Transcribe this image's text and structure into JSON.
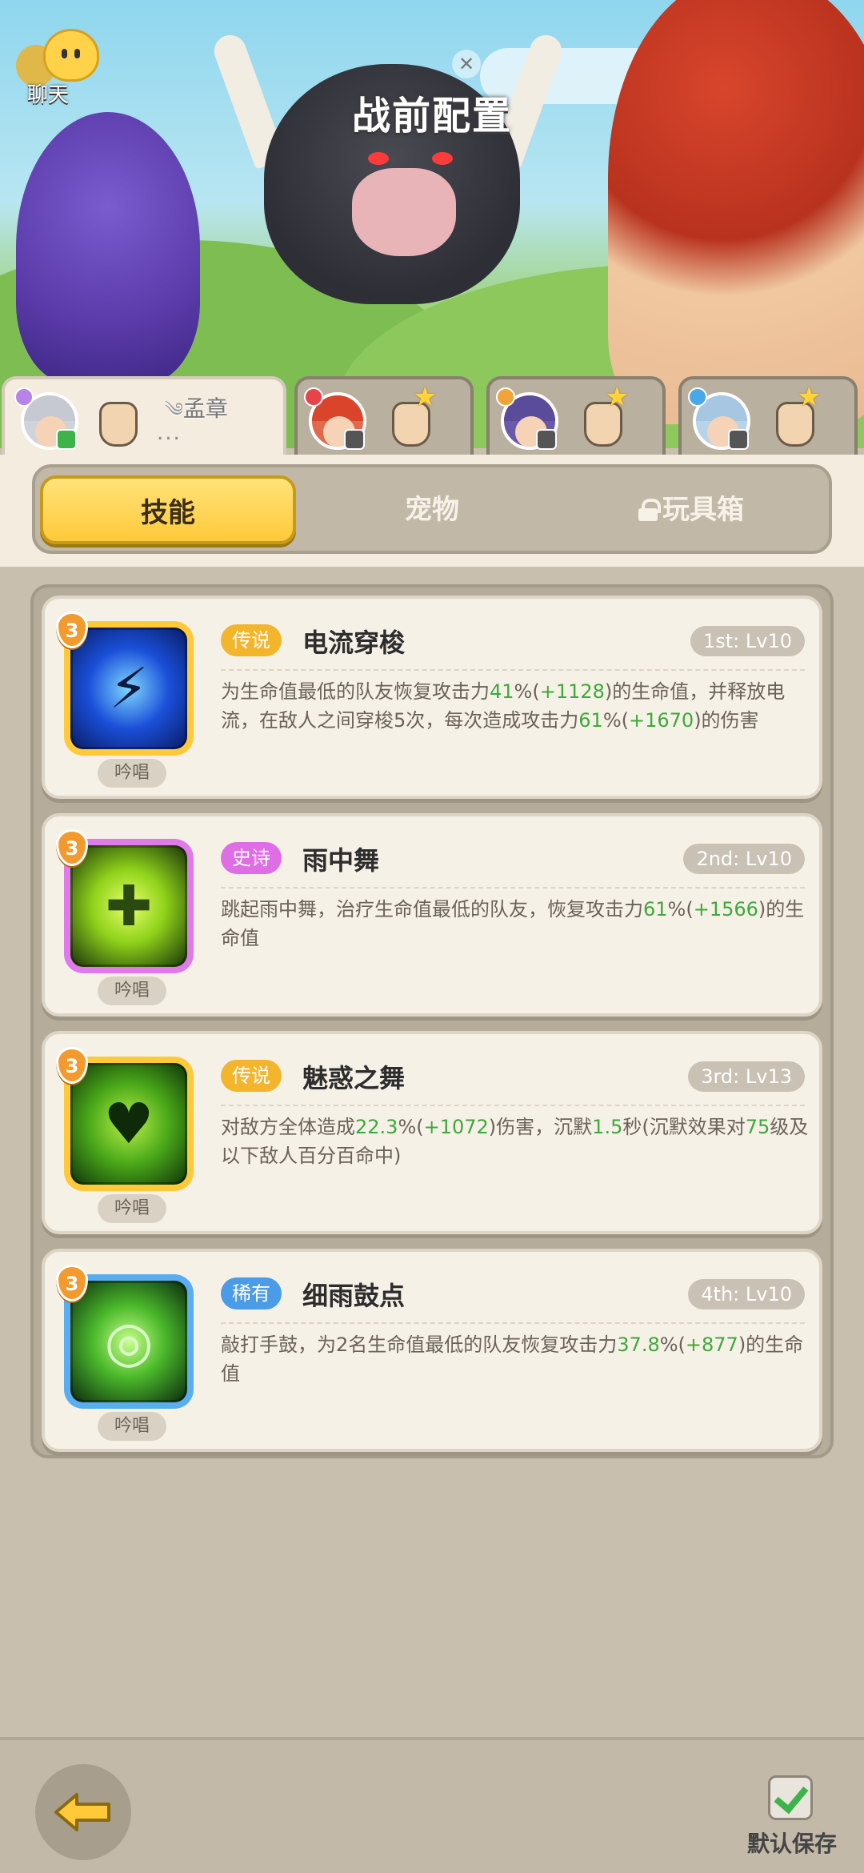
{
  "header": {
    "title": "战前配置",
    "chat_label": "聊天"
  },
  "heroes": [
    {
      "name": "孟章",
      "dots": "...",
      "active": true
    },
    {
      "name": "",
      "active": false
    },
    {
      "name": "",
      "active": false
    },
    {
      "name": "",
      "active": false
    }
  ],
  "category_tabs": [
    {
      "label": "技能",
      "active": true
    },
    {
      "label": "宠物",
      "active": false
    },
    {
      "label": "玩具箱",
      "active": false,
      "locked": true
    }
  ],
  "skills": [
    {
      "rarity": "传说",
      "name": "电流穿梭",
      "slot": "1st: Lv10",
      "level": "3",
      "cast": "吟唱",
      "desc": [
        {
          "t": "为生命值最低的队友恢复攻击力"
        },
        {
          "t": "41",
          "g": true
        },
        {
          "t": "%("
        },
        {
          "t": "+1128",
          "g": true
        },
        {
          "t": ")的生命值，并释放电流，在敌人之间穿梭5次，每次造成攻击力"
        },
        {
          "t": "61",
          "g": true
        },
        {
          "t": "%("
        },
        {
          "t": "+1670",
          "g": true
        },
        {
          "t": ")的伤害"
        }
      ]
    },
    {
      "rarity": "史诗",
      "name": "雨中舞",
      "slot": "2nd: Lv10",
      "level": "3",
      "cast": "吟唱",
      "desc": [
        {
          "t": "跳起雨中舞，治疗生命值最低的队友，恢复攻击力"
        },
        {
          "t": "61",
          "g": true
        },
        {
          "t": "%("
        },
        {
          "t": "+1566",
          "g": true
        },
        {
          "t": ")的生命值"
        }
      ]
    },
    {
      "rarity": "传说",
      "name": "魅惑之舞",
      "slot": "3rd: Lv13",
      "level": "3",
      "cast": "吟唱",
      "desc": [
        {
          "t": "对敌方全体造成"
        },
        {
          "t": "22.3",
          "g": true
        },
        {
          "t": "%("
        },
        {
          "t": "+1072",
          "g": true
        },
        {
          "t": ")伤害，沉默"
        },
        {
          "t": "1.5",
          "g": true
        },
        {
          "t": "秒(沉默效果对"
        },
        {
          "t": "75",
          "g": true
        },
        {
          "t": "级及以下敌人百分百命中)"
        }
      ]
    },
    {
      "rarity": "稀有",
      "name": "细雨鼓点",
      "slot": "4th: Lv10",
      "level": "3",
      "cast": "吟唱",
      "desc": [
        {
          "t": "敲打手鼓，为2名生命值最低的队友恢复攻击力"
        },
        {
          "t": "37.8",
          "g": true
        },
        {
          "t": "%("
        },
        {
          "t": "+877",
          "g": true
        },
        {
          "t": ")的生命值"
        }
      ]
    }
  ],
  "footer": {
    "save_label": "默认保存",
    "save_checked": true
  },
  "colors": {
    "legend": "#f2b52c",
    "epic": "#de6ee6",
    "rare": "#4a9be8",
    "highlight": "#3ea83a"
  }
}
